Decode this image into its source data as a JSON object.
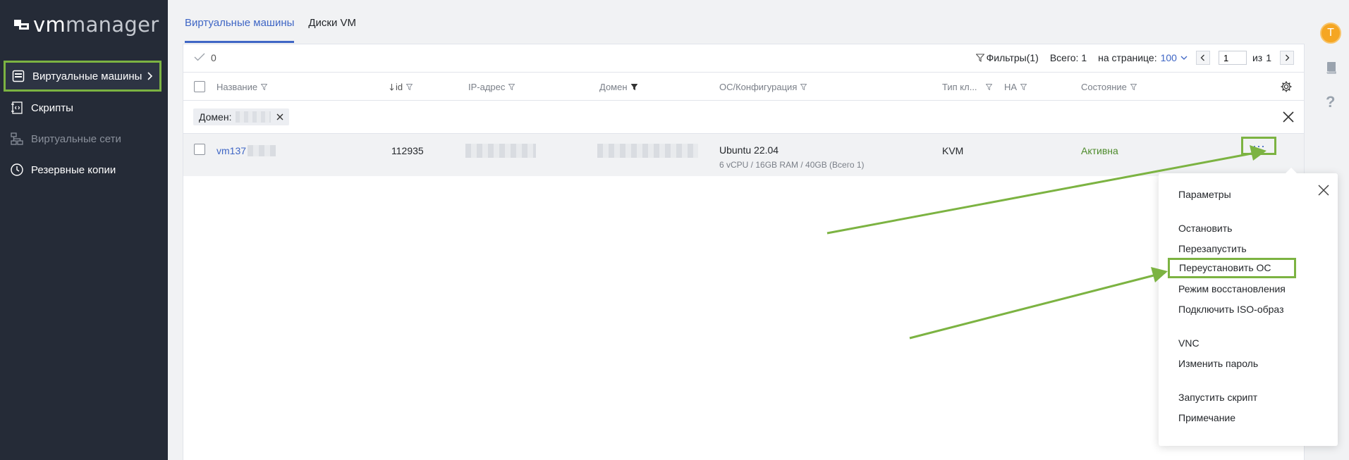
{
  "brand": {
    "logo_bold": "vm",
    "logo_rest": "manager"
  },
  "sidebar": {
    "items": [
      {
        "label": "Виртуальные машины",
        "active": true
      },
      {
        "label": "Скрипты"
      },
      {
        "label": "Виртуальные сети",
        "disabled": true
      },
      {
        "label": "Резервные копии"
      }
    ]
  },
  "tabs": [
    {
      "label": "Виртуальные машины",
      "active": true
    },
    {
      "label": "Диски VM"
    }
  ],
  "toolbar": {
    "selected_count": "0",
    "filters_label": "Фильтры(1)",
    "total_label": "Всего: 1",
    "per_page_label": "на странице:",
    "per_page_value": "100",
    "page_value": "1",
    "of_label": "из",
    "total_pages": "1"
  },
  "table": {
    "columns": [
      "Название",
      "id",
      "IP-адрес",
      "Домен",
      "ОС/Конфигурация",
      "Тип кл...",
      "HA",
      "Состояние"
    ],
    "filter_chip_label": "Домен:",
    "rows": [
      {
        "name": "vm137",
        "id": "112935",
        "os": "Ubuntu 22.04",
        "config": "6 vCPU / 16GB RAM / 40GB (Всего 1)",
        "type": "KVM",
        "status": "Активна",
        "more": "···"
      }
    ]
  },
  "context_menu": {
    "items": [
      "Параметры",
      "Остановить",
      "Перезапустить",
      "Переустановить ОС",
      "Режим восстановления",
      "Подключить ISO-образ",
      "VNC",
      "Изменить пароль",
      "Запустить скрипт",
      "Примечание"
    ],
    "highlighted": "Переустановить ОС"
  },
  "user": {
    "avatar_letter": "T"
  },
  "colors": {
    "accent": "#3f66c5",
    "highlight": "#7cb342",
    "status_active": "#4e8b2c",
    "sidebar_bg": "#252b37"
  }
}
